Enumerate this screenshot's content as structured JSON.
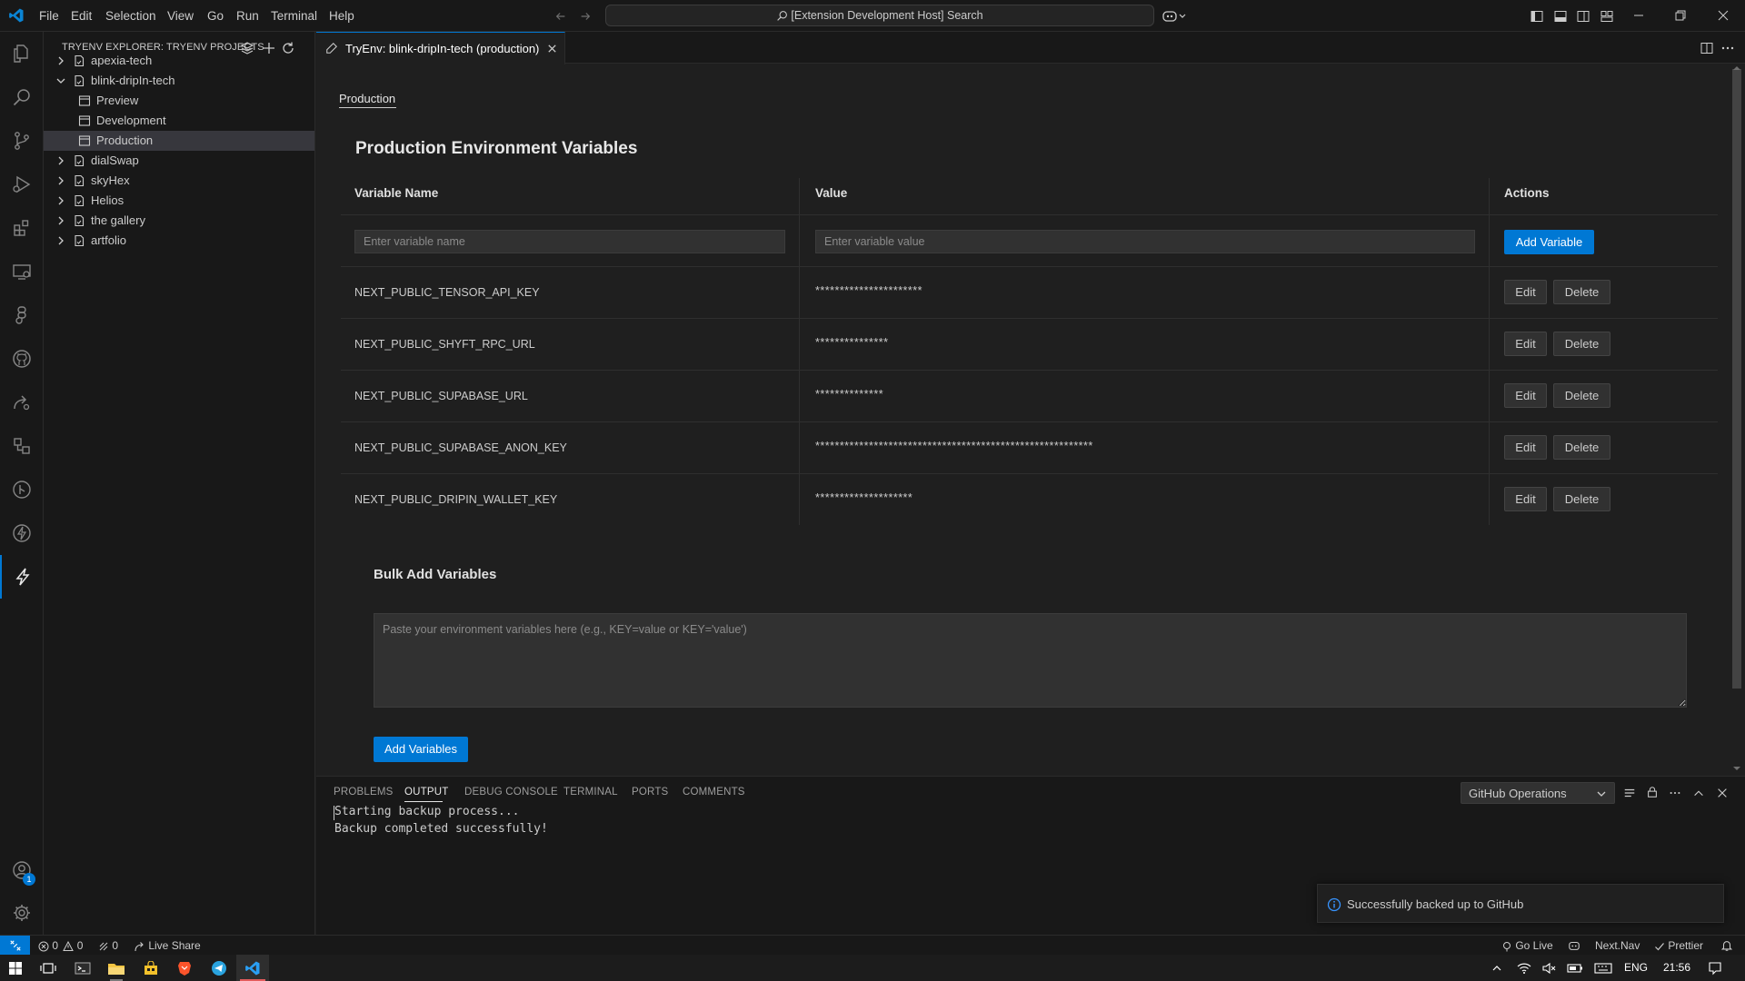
{
  "menu": [
    "File",
    "Edit",
    "Selection",
    "View",
    "Go",
    "Run",
    "Terminal",
    "Help"
  ],
  "search_label": "[Extension Development Host] Search",
  "sidebar": {
    "title": "TRYENV EXPLORER: TRYENV PROJECTS",
    "tree": [
      {
        "label": "apexia-tech",
        "level": 0,
        "expanded": false
      },
      {
        "label": "blink-dripIn-tech",
        "level": 0,
        "expanded": true
      },
      {
        "label": "Preview",
        "level": 1
      },
      {
        "label": "Development",
        "level": 1
      },
      {
        "label": "Production",
        "level": 1,
        "selected": true
      },
      {
        "label": "dialSwap",
        "level": 0,
        "expanded": false
      },
      {
        "label": "skyHex",
        "level": 0,
        "expanded": false
      },
      {
        "label": "Helios",
        "level": 0,
        "expanded": false
      },
      {
        "label": "the gallery",
        "level": 0,
        "expanded": false
      },
      {
        "label": "artfolio",
        "level": 0,
        "expanded": false
      }
    ]
  },
  "tab": {
    "label": "TryEnv: blink-dripIn-tech (production)"
  },
  "editor": {
    "env_tab": "Production",
    "heading": "Production Environment Variables",
    "columns": {
      "name": "Variable Name",
      "value": "Value",
      "actions": "Actions"
    },
    "name_placeholder": "Enter variable name",
    "value_placeholder": "Enter variable value",
    "add_button": "Add Variable",
    "edit_label": "Edit",
    "delete_label": "Delete",
    "variables": [
      {
        "name": "NEXT_PUBLIC_TENSOR_API_KEY",
        "value": "**********************"
      },
      {
        "name": "NEXT_PUBLIC_SHYFT_RPC_URL",
        "value": "***************"
      },
      {
        "name": "NEXT_PUBLIC_SUPABASE_URL",
        "value": "**************"
      },
      {
        "name": "NEXT_PUBLIC_SUPABASE_ANON_KEY",
        "value": "*********************************************************"
      },
      {
        "name": "NEXT_PUBLIC_DRIPIN_WALLET_KEY",
        "value": "********************"
      }
    ],
    "bulk_heading": "Bulk Add Variables",
    "bulk_placeholder": "Paste your environment variables here (e.g., KEY=value or KEY='value')",
    "bulk_button": "Add Variables"
  },
  "panel": {
    "tabs": [
      "PROBLEMS",
      "OUTPUT",
      "DEBUG CONSOLE",
      "TERMINAL",
      "PORTS",
      "COMMENTS"
    ],
    "active_tab": "OUTPUT",
    "channel": "GitHub Operations",
    "output": [
      "Starting backup process...",
      "Backup completed successfully!"
    ]
  },
  "notification": {
    "message": "Successfully backed up to GitHub"
  },
  "statusbar": {
    "errors": "0",
    "warnings": "0",
    "ports": "0",
    "live_share": "Live Share",
    "go_live": "Go Live",
    "nextnav": "Next.Nav",
    "prettier": "Prettier"
  },
  "accounts_badge": "1",
  "taskbar": {
    "lang": "ENG",
    "time": "21:56"
  },
  "colors": {
    "accent": "#0078d4",
    "background": "#1f1f1f",
    "sidebar": "#181818"
  }
}
